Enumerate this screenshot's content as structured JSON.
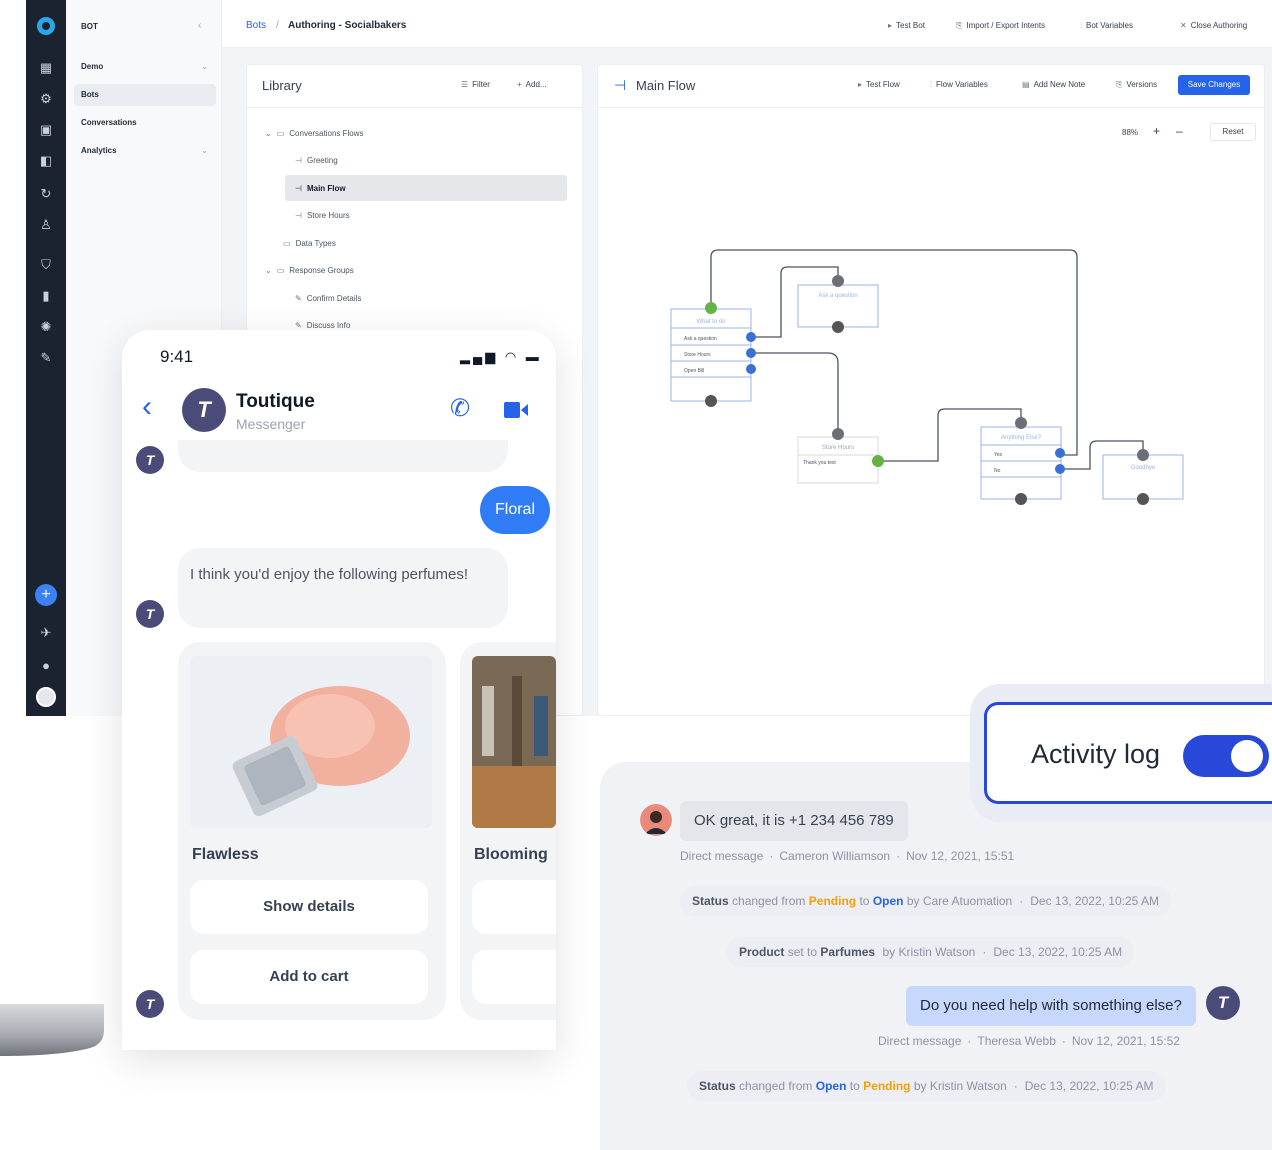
{
  "sidebar_nav": {
    "workspace": "BOT",
    "items": [
      {
        "label": "Demo"
      },
      {
        "label": "Bots"
      },
      {
        "label": "Conversations"
      },
      {
        "label": "Analytics"
      }
    ]
  },
  "header": {
    "breadcrumb_root": "Bots",
    "breadcrumb_sep": "/",
    "breadcrumb_current": "Authoring - Socialbakers",
    "actions": [
      "Test Bot",
      "Import / Export Intents",
      "Bot Variables",
      "Close Authoring"
    ]
  },
  "library": {
    "title": "Library",
    "filter_label": "Filter",
    "add_label": "Add...",
    "tree": [
      {
        "label": "Conversations Flows",
        "icon": "folder-icon"
      },
      {
        "label": "Greeting",
        "icon": "flow-icon"
      },
      {
        "label": "Main Flow",
        "icon": "flow-icon"
      },
      {
        "label": "Store Hours",
        "icon": "flow-icon"
      },
      {
        "label": "Data Types",
        "icon": "folder-icon"
      },
      {
        "label": "Response Groups",
        "icon": "folder-icon"
      },
      {
        "label": "Confirm Details",
        "icon": "response-icon"
      },
      {
        "label": "Discuss Info",
        "icon": "response-icon"
      }
    ]
  },
  "flow": {
    "title": "Main Flow",
    "actions": [
      "Test Flow",
      "Flow Variables",
      "Add New Note",
      "Versions"
    ],
    "save_label": "Save Changes",
    "zoom": "88%",
    "zoom_in": "+",
    "zoom_out": "–",
    "reset_label": "Reset",
    "nodes": {
      "n1_title": "What to do",
      "n1_items": [
        "Ask a question",
        "Store Hours",
        "Open Bill"
      ],
      "n2_title": "Ask a question",
      "n3_title": "Store Hours",
      "n3_item": "Thank you text",
      "n4_title": "Anything Else?",
      "n4_items": [
        "Yes",
        "No"
      ],
      "n5_title": "Goodbye"
    }
  },
  "phone": {
    "time": "9:41",
    "contact_name": "Toutique",
    "contact_sub": "Messenger",
    "avatar_letter": "T",
    "outgoing": "Floral",
    "incoming": "I think you'd enjoy the following perfumes!",
    "cards": [
      {
        "title": "Flawless",
        "btn1": "Show details",
        "btn2": "Add to cart"
      },
      {
        "title": "Blooming",
        "btn1": "",
        "btn2": ""
      }
    ]
  },
  "activity": {
    "toggle_label": "Activity log",
    "toggle_on": true,
    "msg1": "OK great, it is +1 234 456 789",
    "meta1": [
      "Direct message",
      "Cameron Williamson",
      "Nov 12, 2021, 15:51"
    ],
    "status1": {
      "prefix": "Status",
      "changed": "changed from",
      "from": "Pending",
      "to_word": "to",
      "to": "Open",
      "by": "by Care Atuomation",
      "sep": "·",
      "time": "Dec 13, 2022, 10:25 AM"
    },
    "status2": {
      "prefix": "Product",
      "set": "set to",
      "value": "Parfumes",
      "by": "by Kristin Watson",
      "sep": "·",
      "time": "Dec 13, 2022, 10:25 AM"
    },
    "msg2": "Do you need help with something else?",
    "meta2": [
      "Direct message",
      "Theresa Webb",
      "Nov 12, 2021, 15:52"
    ],
    "status3": {
      "prefix": "Status",
      "changed": "changed from",
      "from": "Open",
      "to_word": "to",
      "to": "Pending",
      "by": "by Kristin Watson",
      "sep": "·",
      "time": "Dec 13, 2022, 10:25 AM"
    }
  },
  "colors": {
    "accent": "#2563eb",
    "rail": "#1c2330",
    "toggle": "#2748d8",
    "pending": "#f59e0b",
    "node_border": "#9bb3e8",
    "connector": "#4b5563"
  }
}
